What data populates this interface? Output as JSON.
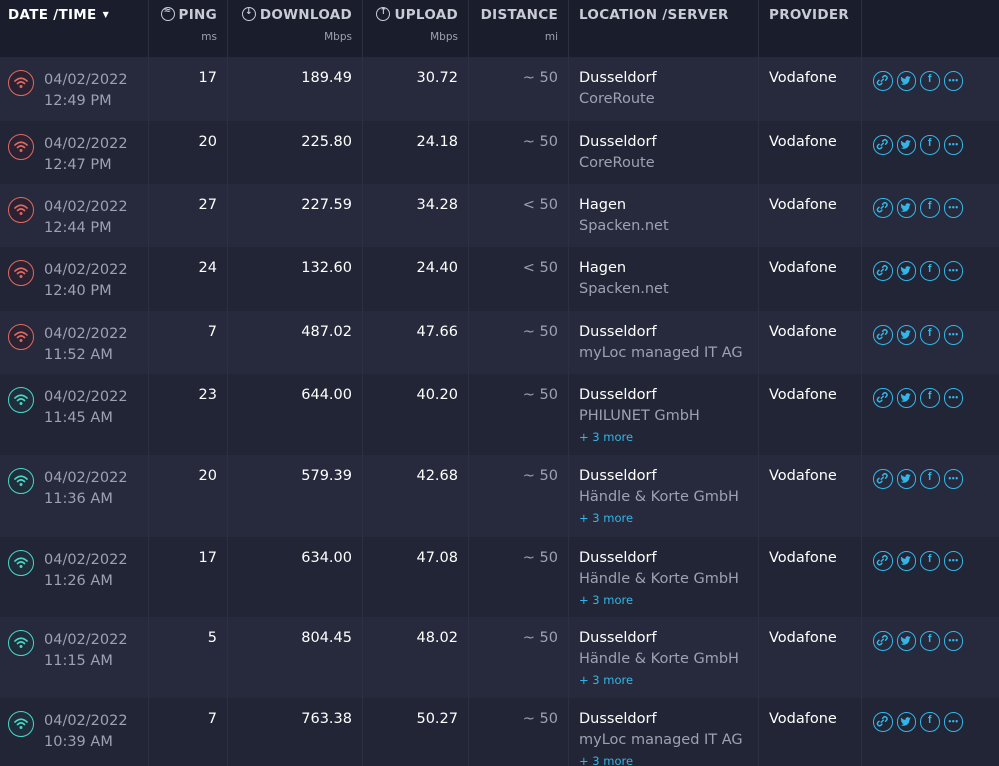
{
  "header": {
    "date_time": "DATE /TIME",
    "ping": "PING",
    "ping_unit": "ms",
    "download": "DOWNLOAD",
    "download_unit": "Mbps",
    "upload": "UPLOAD",
    "upload_unit": "Mbps",
    "distance": "DISTANCE",
    "distance_unit": "mi",
    "location": "LOCATION /SERVER",
    "provider": "PROVIDER"
  },
  "colors": {
    "slow": "#e0695e",
    "fast": "#4ad6c8",
    "accent": "#32b6e8"
  },
  "icons": {
    "status": "wifi-icon",
    "share": [
      "link-icon",
      "twitter-icon",
      "facebook-icon",
      "more-options-icon"
    ]
  },
  "rows": [
    {
      "date": "04/02/2022",
      "time": "12:49 PM",
      "status": "slow",
      "ping": "17",
      "download": "189.49",
      "upload": "30.72",
      "distance": "~ 50",
      "city": "Dusseldorf",
      "server": "CoreRoute",
      "more": "",
      "provider": "Vodafone"
    },
    {
      "date": "04/02/2022",
      "time": "12:47 PM",
      "status": "slow",
      "ping": "20",
      "download": "225.80",
      "upload": "24.18",
      "distance": "~ 50",
      "city": "Dusseldorf",
      "server": "CoreRoute",
      "more": "",
      "provider": "Vodafone"
    },
    {
      "date": "04/02/2022",
      "time": "12:44 PM",
      "status": "slow",
      "ping": "27",
      "download": "227.59",
      "upload": "34.28",
      "distance": "< 50",
      "city": "Hagen",
      "server": "Spacken.net",
      "more": "",
      "provider": "Vodafone"
    },
    {
      "date": "04/02/2022",
      "time": "12:40 PM",
      "status": "slow",
      "ping": "24",
      "download": "132.60",
      "upload": "24.40",
      "distance": "< 50",
      "city": "Hagen",
      "server": "Spacken.net",
      "more": "",
      "provider": "Vodafone"
    },
    {
      "date": "04/02/2022",
      "time": "11:52 AM",
      "status": "slow",
      "ping": "7",
      "download": "487.02",
      "upload": "47.66",
      "distance": "~ 50",
      "city": "Dusseldorf",
      "server": "myLoc managed IT AG",
      "more": "",
      "provider": "Vodafone"
    },
    {
      "date": "04/02/2022",
      "time": "11:45 AM",
      "status": "fast",
      "ping": "23",
      "download": "644.00",
      "upload": "40.20",
      "distance": "~ 50",
      "city": "Dusseldorf",
      "server": "PHILUNET GmbH",
      "more": "+ 3 more",
      "provider": "Vodafone"
    },
    {
      "date": "04/02/2022",
      "time": "11:36 AM",
      "status": "fast",
      "ping": "20",
      "download": "579.39",
      "upload": "42.68",
      "distance": "~ 50",
      "city": "Dusseldorf",
      "server": "Händle & Korte GmbH",
      "more": "+ 3 more",
      "provider": "Vodafone"
    },
    {
      "date": "04/02/2022",
      "time": "11:26 AM",
      "status": "fast",
      "ping": "17",
      "download": "634.00",
      "upload": "47.08",
      "distance": "~ 50",
      "city": "Dusseldorf",
      "server": "Händle & Korte GmbH",
      "more": "+ 3 more",
      "provider": "Vodafone"
    },
    {
      "date": "04/02/2022",
      "time": "11:15 AM",
      "status": "fast",
      "ping": "5",
      "download": "804.45",
      "upload": "48.02",
      "distance": "~ 50",
      "city": "Dusseldorf",
      "server": "Händle & Korte GmbH",
      "more": "+ 3 more",
      "provider": "Vodafone"
    },
    {
      "date": "04/02/2022",
      "time": "10:39 AM",
      "status": "fast",
      "ping": "7",
      "download": "763.38",
      "upload": "50.27",
      "distance": "~ 50",
      "city": "Dusseldorf",
      "server": "myLoc managed IT AG",
      "more": "+ 3 more",
      "provider": "Vodafone"
    }
  ]
}
